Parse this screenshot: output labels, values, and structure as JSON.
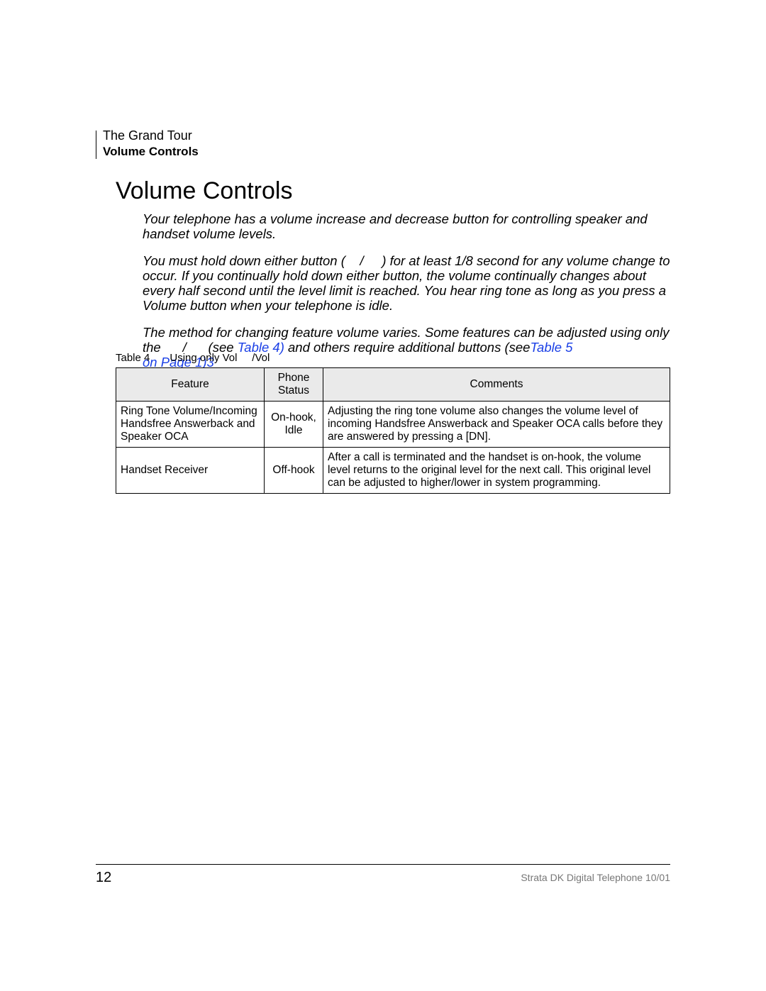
{
  "header": {
    "chapter": "The Grand Tour",
    "section": "Volume Controls"
  },
  "title": "Volume Controls",
  "paragraphs": {
    "p1": "Your telephone has a volume increase and decrease button for controlling speaker and handset volume levels.",
    "p2a": "You must hold down either button (",
    "p2b": "/",
    "p2c": ") for at least 1/8 second for any volume change to occur. If you continually hold down either button, the volume continually changes about every half second until the level limit is reached. You hear ring tone as long as you press a Volume button when your telephone is idle.",
    "p3a": "The method for changing feature volume varies. Some features can be adjusted using only the ",
    "p3b": "/",
    "p3c": " (see ",
    "link1": "Table 4)",
    "p3d": " and others require additional buttons (see",
    "link2a": "Table 5",
    "link2b": "on Page 13).",
    "link2b_visible": "on Page 1)3"
  },
  "table_caption": {
    "label": "Table 4",
    "text_a": "Using only Vol",
    "text_b": "/Vol"
  },
  "table": {
    "headers": {
      "feature": "Feature",
      "status": "Phone Status",
      "comments": "Comments"
    },
    "rows": [
      {
        "feature": "Ring Tone Volume/Incoming Handsfree Answerback and Speaker OCA",
        "status": "On-hook, Idle",
        "comments": "Adjusting the ring tone volume also changes the volume level of incoming Handsfree Answerback and Speaker OCA calls before they are answered by pressing a [DN]."
      },
      {
        "feature": "Handset Receiver",
        "status": "Off-hook",
        "comments": "After a call is terminated and the handset is on-hook, the volume level returns to the  original  level for the next call. This  original  level can be adjusted to higher/lower in system programming."
      }
    ]
  },
  "footer": {
    "page": "12",
    "doc": "Strata DK Digital Telephone   10/01"
  }
}
